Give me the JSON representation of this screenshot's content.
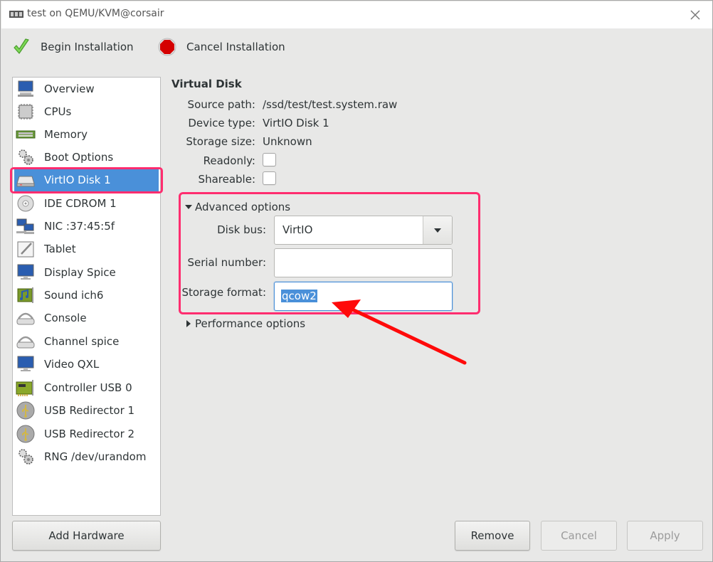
{
  "window": {
    "title": "test on QEMU/KVM@corsair",
    "icon": "virt-manager-icon",
    "close_icon": "close-icon"
  },
  "toolbar": {
    "begin_installation": {
      "label": "Begin Installation",
      "icon": "checkmark-icon",
      "color": "#6cc644"
    },
    "cancel_installation": {
      "label": "Cancel Installation",
      "icon": "stop-icon",
      "color": "#d40000"
    }
  },
  "sidebar": {
    "selected_index": 4,
    "items": [
      {
        "label": "Overview",
        "icon": "monitor-icon"
      },
      {
        "label": "CPUs",
        "icon": "cpu-icon"
      },
      {
        "label": "Memory",
        "icon": "memory-icon"
      },
      {
        "label": "Boot Options",
        "icon": "gears-icon"
      },
      {
        "label": "VirtIO Disk 1",
        "icon": "harddisk-icon"
      },
      {
        "label": "IDE CDROM 1",
        "icon": "cdrom-icon"
      },
      {
        "label": "NIC :37:45:5f",
        "icon": "network-icon"
      },
      {
        "label": "Tablet",
        "icon": "tablet-icon"
      },
      {
        "label": "Display Spice",
        "icon": "monitor-icon"
      },
      {
        "label": "Sound ich6",
        "icon": "sound-card-icon"
      },
      {
        "label": "Console",
        "icon": "serial-icon"
      },
      {
        "label": "Channel spice",
        "icon": "serial-icon"
      },
      {
        "label": "Video QXL",
        "icon": "monitor-icon"
      },
      {
        "label": "Controller USB 0",
        "icon": "pci-card-icon"
      },
      {
        "label": "USB Redirector 1",
        "icon": "usb-icon"
      },
      {
        "label": "USB Redirector 2",
        "icon": "usb-icon"
      },
      {
        "label": "RNG /dev/urandom",
        "icon": "gears-icon"
      }
    ],
    "add_hardware_label": "Add Hardware"
  },
  "details": {
    "title": "Virtual Disk",
    "source_path_label": "Source path:",
    "source_path_value": "/ssd/test/test.system.raw",
    "device_type_label": "Device type:",
    "device_type_value": "VirtIO Disk 1",
    "storage_size_label": "Storage size:",
    "storage_size_value": "Unknown",
    "readonly_label": "Readonly:",
    "readonly_checked": false,
    "shareable_label": "Shareable:",
    "shareable_checked": false,
    "advanced": {
      "label": "Advanced options",
      "expanded": true,
      "disk_bus_label": "Disk bus:",
      "disk_bus_value": "VirtIO",
      "serial_label": "Serial number:",
      "serial_value": "",
      "storage_format_label": "Storage format:",
      "storage_format_value": "qcow2"
    },
    "performance": {
      "label": "Performance options",
      "expanded": false
    }
  },
  "buttons": {
    "remove": "Remove",
    "cancel": "Cancel",
    "apply": "Apply"
  },
  "annotation": {
    "highlight_color": "#ff2d6f",
    "arrow_color": "#ff0000"
  }
}
